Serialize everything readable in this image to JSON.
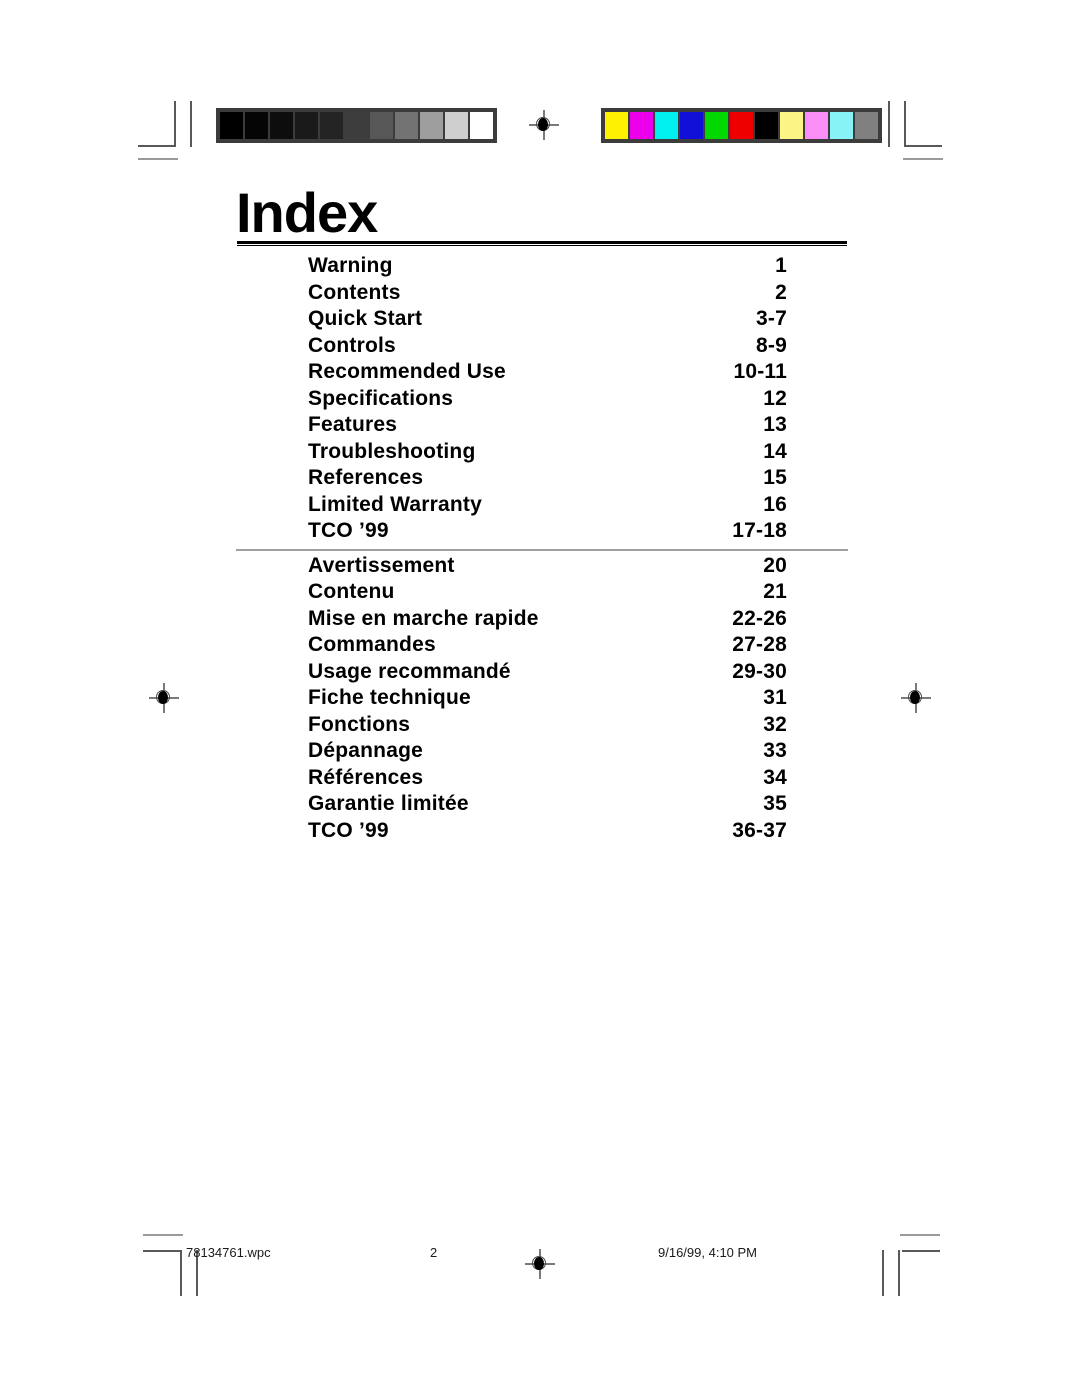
{
  "document": {
    "title": "Index"
  },
  "index": {
    "sections": [
      {
        "name": "english",
        "entries": [
          {
            "label": "Warning",
            "pages": "1"
          },
          {
            "label": "Contents",
            "pages": "2"
          },
          {
            "label": "Quick Start",
            "pages": "3-7"
          },
          {
            "label": "Controls",
            "pages": "8-9"
          },
          {
            "label": "Recommended Use",
            "pages": "10-11"
          },
          {
            "label": "Specifications",
            "pages": "12"
          },
          {
            "label": "Features",
            "pages": "13"
          },
          {
            "label": "Troubleshooting",
            "pages": "14"
          },
          {
            "label": "References",
            "pages": "15"
          },
          {
            "label": "Limited Warranty",
            "pages": "16"
          },
          {
            "label": "TCO ’99",
            "pages": "17-18"
          }
        ]
      },
      {
        "name": "french",
        "entries": [
          {
            "label": "Avertissement",
            "pages": "20"
          },
          {
            "label": "Contenu",
            "pages": "21"
          },
          {
            "label": "Mise en marche rapide",
            "pages": "22-26"
          },
          {
            "label": "Commandes",
            "pages": "27-28"
          },
          {
            "label": "Usage recommandé",
            "pages": "29-30"
          },
          {
            "label": "Fiche technique",
            "pages": "31"
          },
          {
            "label": "Fonctions",
            "pages": "32"
          },
          {
            "label": "Dépannage",
            "pages": "33"
          },
          {
            "label": "Références",
            "pages": "34"
          },
          {
            "label": "Garantie limitée",
            "pages": "35"
          },
          {
            "label": "TCO ’99",
            "pages": "36-37"
          }
        ]
      }
    ]
  },
  "print_marks": {
    "grayscale_bar": {
      "name": "grayscale-calibration-bar",
      "swatches": [
        "#000000",
        "#050505",
        "#0d0d0d",
        "#1a1a1a",
        "#242424",
        "#3d3d3d",
        "#575757",
        "#737373",
        "#9e9e9e",
        "#cfcfcf",
        "#ffffff"
      ]
    },
    "color_bar": {
      "name": "color-calibration-bar",
      "swatches": [
        "#fff200",
        "#ec00ec",
        "#00f0f0",
        "#1010d8",
        "#00d800",
        "#ee0000",
        "#000000",
        "#fdf486",
        "#fb8df9",
        "#88f3f6",
        "#808080"
      ]
    }
  },
  "footer": {
    "filename": "78134761.wpc",
    "page_number": "2",
    "timestamp": "9/16/99, 4:10 PM"
  }
}
